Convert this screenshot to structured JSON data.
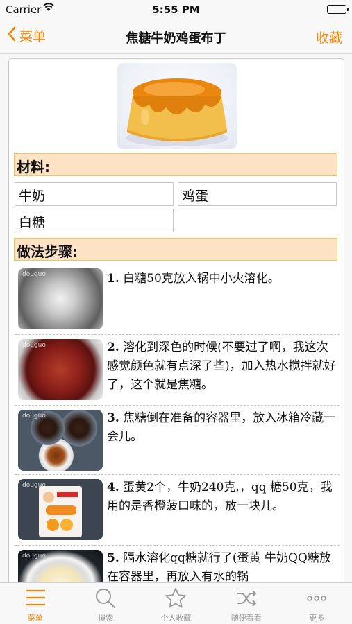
{
  "status_bar": {
    "carrier": "Carrier",
    "time": "5:55 PM"
  },
  "nav": {
    "back_label": "菜单",
    "title": "焦糖牛奶鸡蛋布丁",
    "favorite_label": "收藏"
  },
  "ingredients": {
    "header": "材料:",
    "items": [
      "牛奶",
      "鸡蛋",
      "白糖"
    ]
  },
  "steps": {
    "header": "做法步骤:",
    "watermark": "douguo",
    "items": [
      {
        "num": "1.",
        "text": "白糖50克放入锅中小火溶化。"
      },
      {
        "num": "2.",
        "text": "溶化到深色的时候(不要过了啊，我这次感觉颜色就有点深了些)，加入热水搅拌就好了，这个就是焦糖。"
      },
      {
        "num": "3.",
        "text": "焦糖倒在准备的容器里，放入冰箱冷藏一会儿。"
      },
      {
        "num": "4.",
        "text": "蛋黄2个，牛奶240克,，qq 糖50克，我用的是香橙菠口味的，放一块儿。"
      },
      {
        "num": "5.",
        "text": "隔水溶化qq糖就行了(蛋黄 牛奶QQ糖放在容器里，再放入有水的锅"
      }
    ]
  },
  "tab_bar": {
    "items": [
      {
        "label": "菜单",
        "icon": "menu-icon",
        "active": true
      },
      {
        "label": "搜索",
        "icon": "search-icon",
        "active": false
      },
      {
        "label": "个人收藏",
        "icon": "star-icon",
        "active": false
      },
      {
        "label": "随便看看",
        "icon": "shuffle-icon",
        "active": false
      },
      {
        "label": "更多",
        "icon": "more-icon",
        "active": false
      }
    ]
  },
  "colors": {
    "accent": "#f0890a",
    "section_bg": "#fde2c6",
    "section_border": "#f0c64d"
  }
}
